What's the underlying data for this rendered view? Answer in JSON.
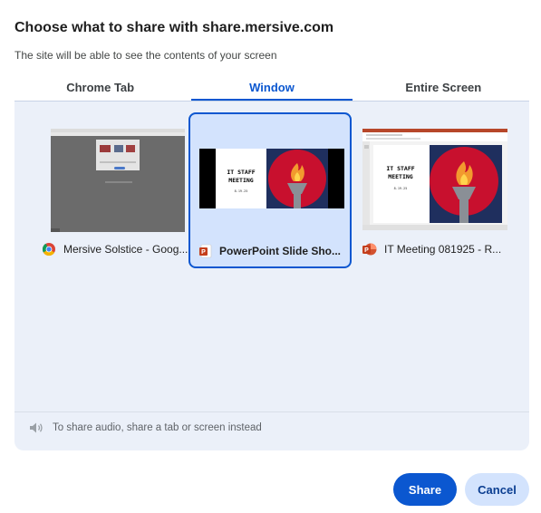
{
  "dialog": {
    "title": "Choose what to share with share.mersive.com",
    "subtitle": "The site will be able to see the contents of your screen"
  },
  "tabs": [
    {
      "label": "Chrome Tab",
      "active": false
    },
    {
      "label": "Window",
      "active": true
    },
    {
      "label": "Entire Screen",
      "active": false
    }
  ],
  "sources": [
    {
      "label": "Mersive Solstice - Goog...",
      "icon": "chrome-icon",
      "selected": false
    },
    {
      "label": "PowerPoint Slide Sho...",
      "icon": "powerpoint-icon",
      "selected": true
    },
    {
      "label": "IT Meeting 081925  -  R...",
      "icon": "powerpoint-icon",
      "selected": false
    }
  ],
  "slide": {
    "line1": "IT STAFF",
    "line2": "MEETING",
    "line3": "8.19.25"
  },
  "audio": {
    "icon": "speaker-icon",
    "text": "To share audio, share a tab or screen instead"
  },
  "buttons": {
    "share": "Share",
    "cancel": "Cancel"
  },
  "colors": {
    "accent": "#0b57d0",
    "panel": "#ebf0f9",
    "selected_bg": "#d3e3fd",
    "powerpoint": "#c43e1c",
    "slide_red": "#c8102e",
    "slide_navy": "#1f2f5e"
  }
}
